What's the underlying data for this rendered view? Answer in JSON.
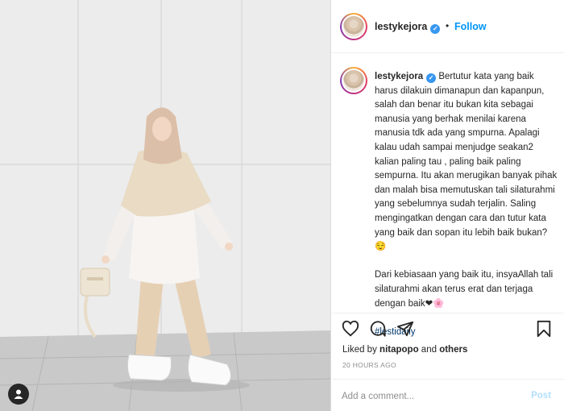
{
  "post": {
    "username": "lestykejora",
    "verified_icon": "verified-badge-icon",
    "follow_label": "Follow",
    "separator": "•"
  },
  "caption": {
    "username": "lestykejora",
    "paragraph1": "Bertutur kata yang baik harus dilakuin dimanapun dan kapanpun, salah dan benar itu bukan kita sebagai manusia yang berhak menilai karena manusia tdk ada yang smpurna. Apalagi kalau udah sampai menjudge seakan2 kalian paling tau , paling baik paling sempurna. Itu akan merugikan banyak pihak dan malah bisa memutuskan tali silaturahmi yang sebelumnya sudah terjalin. Saling mengingatkan dengan cara dan tutur kata yang baik dan sopan itu lebih baik bukan? 😌",
    "paragraph2": "Dari kebiasaan yang baik itu, insyaAllah tali silaturahmi akan terus erat dan terjaga dengan baik❤🌸",
    "hashtag": "#lestidaily"
  },
  "actions": {
    "like_icon": "heart-icon",
    "comment_icon": "comment-icon",
    "share_icon": "share-icon",
    "save_icon": "bookmark-icon"
  },
  "likes": {
    "prefix": "Liked by",
    "user": "nitapopo",
    "conjunction": "and",
    "others": "others"
  },
  "timestamp": "20 HOURS AGO",
  "comment": {
    "placeholder": "Add a comment...",
    "post_label": "Post"
  },
  "colors": {
    "link_blue": "#0095f6",
    "post_disabled": "#b2dffc",
    "text": "#262626",
    "muted": "#8e8e8e"
  }
}
